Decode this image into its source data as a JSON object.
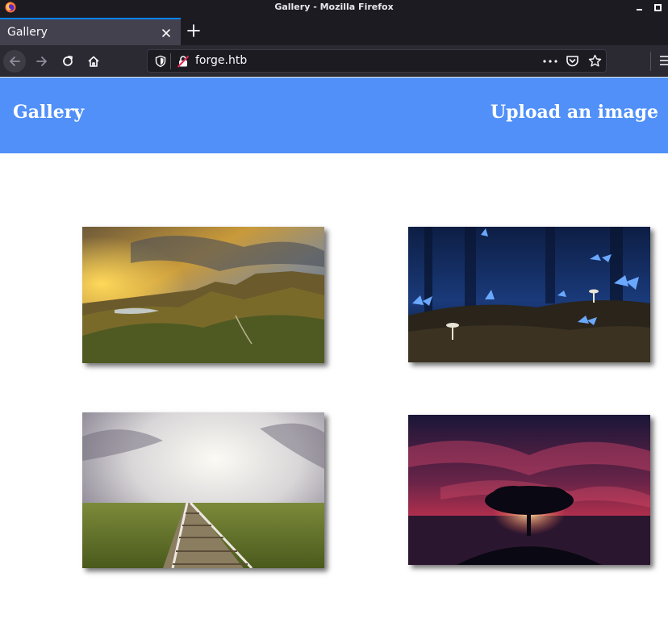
{
  "window": {
    "title": "Gallery - Mozilla Firefox"
  },
  "tabs": [
    {
      "label": "Gallery",
      "active": true
    }
  ],
  "address_bar": {
    "url": "forge.htb"
  },
  "icons": {
    "app": "firefox-icon",
    "tab_close": "close-icon",
    "new_tab": "plus-icon",
    "back": "arrow-left-icon",
    "forward": "arrow-right-icon",
    "reload": "reload-icon",
    "home": "home-icon",
    "tracking": "shield-icon",
    "insecure": "insecure-lock-icon",
    "page_actions": "more-horizontal-icon",
    "pocket": "pocket-icon",
    "bookmark": "star-icon",
    "menu": "hamburger-icon"
  },
  "page": {
    "brand": "Gallery",
    "upload_link": "Upload an image",
    "header_color": "#5090f8"
  },
  "gallery": [
    {
      "subject": "mountain landscape at sunset"
    },
    {
      "subject": "blue butterflies and mushrooms in a dark forest"
    },
    {
      "subject": "railway track under a cloudy sky"
    },
    {
      "subject": "silhouette of a tree against a red night sky"
    }
  ]
}
